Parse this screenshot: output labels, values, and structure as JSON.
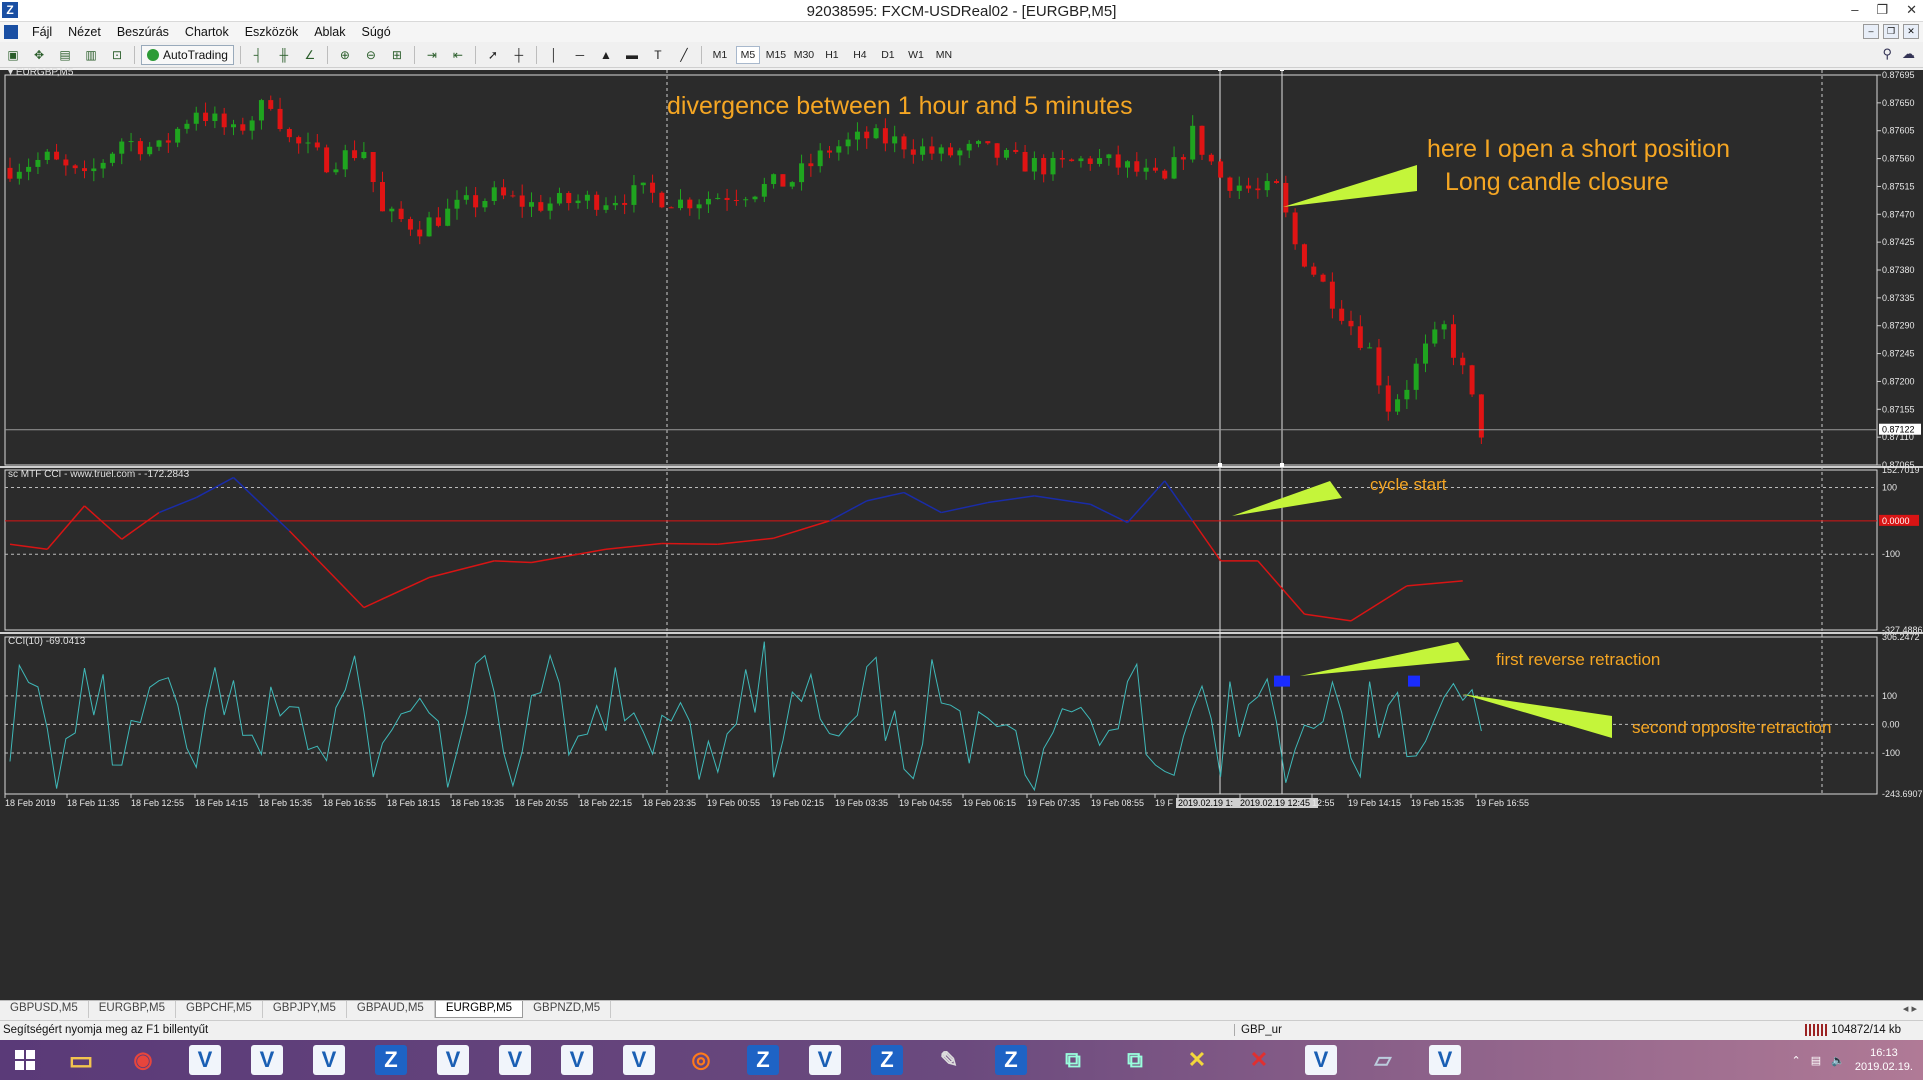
{
  "window": {
    "title": "92038595: FXCM-USDReal02 - [EURGBP,M5]",
    "controls": [
      "–",
      "❐",
      "✕"
    ]
  },
  "menu": {
    "items": [
      "Fájl",
      "Nézet",
      "Beszúrás",
      "Chartok",
      "Eszközök",
      "Ablak",
      "Súgó"
    ]
  },
  "toolbar": {
    "autotrading_label": "AutoTrading",
    "timeframes": [
      "M1",
      "M5",
      "M15",
      "M30",
      "H1",
      "H4",
      "D1",
      "W1",
      "MN"
    ],
    "active_timeframe": "M5"
  },
  "panes": {
    "main_label": "EURGBP,M5",
    "mtf_cci_label": "sc MTF CCI - www.truel.com - -172.2843",
    "cci_label": "CCI(10) -69.0413"
  },
  "annotations": {
    "divergence": "divergence between 1 hour and 5 minutes",
    "short_position": "here I open a short position",
    "long_candle": "Long candle closure",
    "cycle_start": "cycle start",
    "first_reverse": "first reverse retraction",
    "second_opposite": "second opposite retraction"
  },
  "colors": {
    "chart_bg": "#2b2b2b",
    "bull_candle": "#1fa51f",
    "bear_candle": "#e01414",
    "annotation_text": "#f5a623",
    "annotation_arrow": "#c4f53a",
    "cci_line": "#3fb8b8",
    "mtf_up": "#1a2ca8",
    "mtf_down": "#d81414",
    "marker": "#1a2cff"
  },
  "chart_data": [
    {
      "type": "candlestick",
      "title": "EURGBP,M5",
      "y_ticks": [
        "0.87695",
        "0.87650",
        "0.87605",
        "0.87560",
        "0.87515",
        "0.87470",
        "0.87425",
        "0.87380",
        "0.87335",
        "0.87290",
        "0.87245",
        "0.87200",
        "0.87155",
        "0.87110",
        "0.87065"
      ],
      "ylim": [
        0.87065,
        0.87695
      ],
      "current_price": "0.87122",
      "close_path": [
        [
          0,
          0.87545
        ],
        [
          4,
          0.8756
        ],
        [
          8,
          0.87525
        ],
        [
          12,
          0.8759
        ],
        [
          16,
          0.87575
        ],
        [
          20,
          0.8764
        ],
        [
          24,
          0.876
        ],
        [
          28,
          0.87655
        ],
        [
          30,
          0.8759
        ],
        [
          34,
          0.87555
        ],
        [
          38,
          0.87575
        ],
        [
          40,
          0.8747
        ],
        [
          44,
          0.8745
        ],
        [
          48,
          0.8748
        ],
        [
          52,
          0.875
        ],
        [
          56,
          0.87485
        ],
        [
          60,
          0.8749
        ],
        [
          64,
          0.87495
        ],
        [
          68,
          0.87505
        ],
        [
          72,
          0.8749
        ],
        [
          76,
          0.875
        ],
        [
          80,
          0.8751
        ],
        [
          84,
          0.87525
        ],
        [
          88,
          0.87575
        ],
        [
          92,
          0.87595
        ],
        [
          96,
          0.87585
        ],
        [
          100,
          0.87565
        ],
        [
          104,
          0.87575
        ],
        [
          108,
          0.87555
        ],
        [
          112,
          0.87545
        ],
        [
          116,
          0.8756
        ],
        [
          120,
          0.87545
        ],
        [
          124,
          0.8752
        ],
        [
          127,
          0.876
        ],
        [
          130,
          0.8753
        ],
        [
          134,
          0.87505
        ],
        [
          136,
          0.8751
        ],
        [
          138,
          0.8742
        ],
        [
          142,
          0.87335
        ],
        [
          146,
          0.8725
        ],
        [
          148,
          0.8716
        ],
        [
          150,
          0.87195
        ],
        [
          152,
          0.8725
        ],
        [
          154,
          0.87285
        ],
        [
          156,
          0.87215
        ],
        [
          158,
          0.8712
        ]
      ],
      "time_labels": [
        "18 Feb 2019",
        "18 Feb 11:35",
        "18 Feb 12:55",
        "18 Feb 14:15",
        "18 Feb 15:35",
        "18 Feb 16:55",
        "18 Feb 18:15",
        "18 Feb 19:35",
        "18 Feb 20:55",
        "18 Feb 22:15",
        "18 Feb 23:35",
        "19 Feb 00:55",
        "19 Feb 02:15",
        "19 Feb 03:35",
        "19 Feb 04:55",
        "19 Feb 06:15",
        "19 Feb 07:35",
        "19 Feb 08:55",
        "19 F",
        "2019.02.19 1:",
        "2019.02.19 12:45",
        "12:55",
        "19 Feb 14:15",
        "19 Feb 15:35",
        "19 Feb 16:55"
      ]
    },
    {
      "type": "line",
      "title": "sc MTF CCI - www.truel.com - -172.2843",
      "y_ticks": [
        "152.7019",
        "100",
        "0.0000",
        "-100",
        "-327.4886"
      ],
      "ylim": [
        -327.4886,
        152.7019
      ],
      "series": [
        {
          "values": [
            [
              0,
              -70
            ],
            [
              4,
              -85
            ],
            [
              8,
              45
            ],
            [
              12,
              -55
            ],
            [
              16,
              25
            ],
            [
              20,
              70
            ],
            [
              24,
              130
            ],
            [
              30,
              -30
            ],
            [
              38,
              -260
            ],
            [
              45,
              -170
            ],
            [
              52,
              -120
            ],
            [
              56,
              -125
            ],
            [
              64,
              -85
            ],
            [
              70,
              -68
            ],
            [
              76,
              -70
            ],
            [
              82,
              -52
            ],
            [
              88,
              0
            ],
            [
              92,
              60
            ],
            [
              96,
              85
            ],
            [
              100,
              25
            ],
            [
              105,
              55
            ],
            [
              110,
              75
            ],
            [
              116,
              50
            ],
            [
              120,
              -5
            ],
            [
              124,
              120
            ],
            [
              127,
              0
            ],
            [
              130,
              -120
            ],
            [
              134,
              -120
            ],
            [
              139,
              -280
            ],
            [
              144,
              -300
            ],
            [
              150,
              -195
            ],
            [
              156,
              -180
            ]
          ]
        }
      ]
    },
    {
      "type": "line",
      "title": "CCI(10) -69.0413",
      "y_ticks": [
        "306.2472",
        "100",
        "0.00",
        "-100",
        "-243.6907"
      ],
      "ylim": [
        -243.6907,
        306.2472
      ],
      "series": [
        {
          "values": []
        }
      ]
    }
  ],
  "tabs": [
    "GBPUSD,M5",
    "EURGBP,M5",
    "GBPCHF,M5",
    "GBPJPY,M5",
    "GBPAUD,M5",
    "EURGBP,M5",
    "GBPNZD,M5"
  ],
  "active_tab": 5,
  "status": {
    "help": "Segítségért nyomja meg az F1 billentyűt",
    "profile": "GBP_ur",
    "connection": "104872/14 kb"
  },
  "taskbar": {
    "time": "16:13",
    "date": "2019.02.19."
  }
}
